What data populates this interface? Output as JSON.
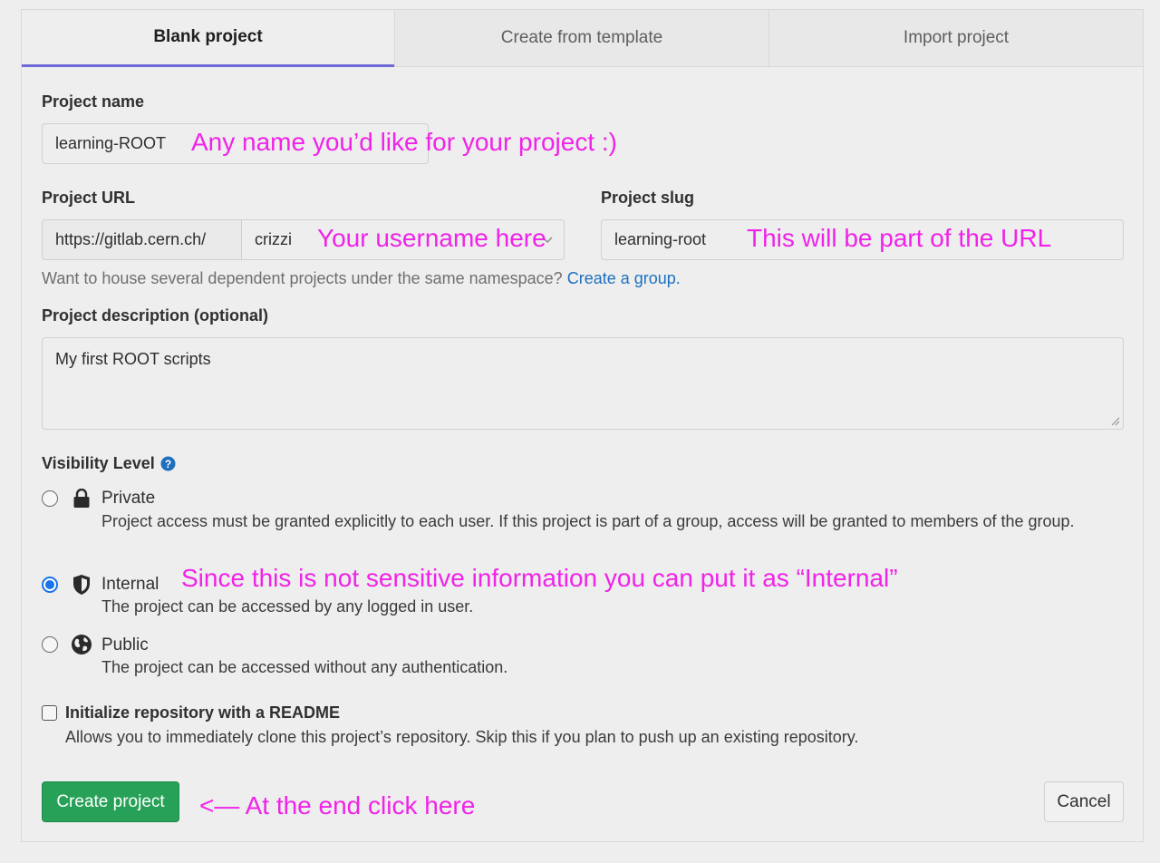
{
  "tabs": [
    {
      "label": "Blank project",
      "active": true
    },
    {
      "label": "Create from template",
      "active": false
    },
    {
      "label": "Import project",
      "active": false
    }
  ],
  "project_name": {
    "label": "Project name",
    "value": "learning-ROOT",
    "annotation": "Any name you’d like for your project :)"
  },
  "project_url": {
    "label": "Project URL",
    "prefix": "https://gitlab.cern.ch/",
    "namespace": "crizzi",
    "annotation": "Your username here"
  },
  "project_slug": {
    "label": "Project slug",
    "value": "learning-root",
    "annotation": "This will be part of the URL"
  },
  "namespace_hint": {
    "text": "Want to house several dependent projects under the same namespace?",
    "link": "Create a group."
  },
  "description": {
    "label": "Project description (optional)",
    "value": "My first ROOT scripts"
  },
  "visibility": {
    "label": "Visibility Level",
    "options": [
      {
        "title": "Private",
        "icon": "lock-icon",
        "checked": false,
        "description": "Project access must be granted explicitly to each user. If this project is part of a group, access will be granted to members of the group."
      },
      {
        "title": "Internal",
        "icon": "shield-icon",
        "checked": true,
        "description": "The project can be accessed by any logged in user.",
        "annotation": "Since this is not sensitive information you can put it as “Internal”"
      },
      {
        "title": "Public",
        "icon": "globe-icon",
        "checked": false,
        "description": "The project can be accessed without any authentication."
      }
    ]
  },
  "readme": {
    "label": "Initialize repository with a README",
    "description": "Allows you to immediately clone this project’s repository. Skip this if you plan to push up an existing repository.",
    "checked": false
  },
  "actions": {
    "create": "Create project",
    "create_annotation": "<— At the end click here",
    "cancel": "Cancel"
  },
  "colors": {
    "annotation": "#f023e8",
    "primary": "#27a157",
    "tab_active_underline": "#6e6ad8",
    "link": "#1f6fbf"
  }
}
